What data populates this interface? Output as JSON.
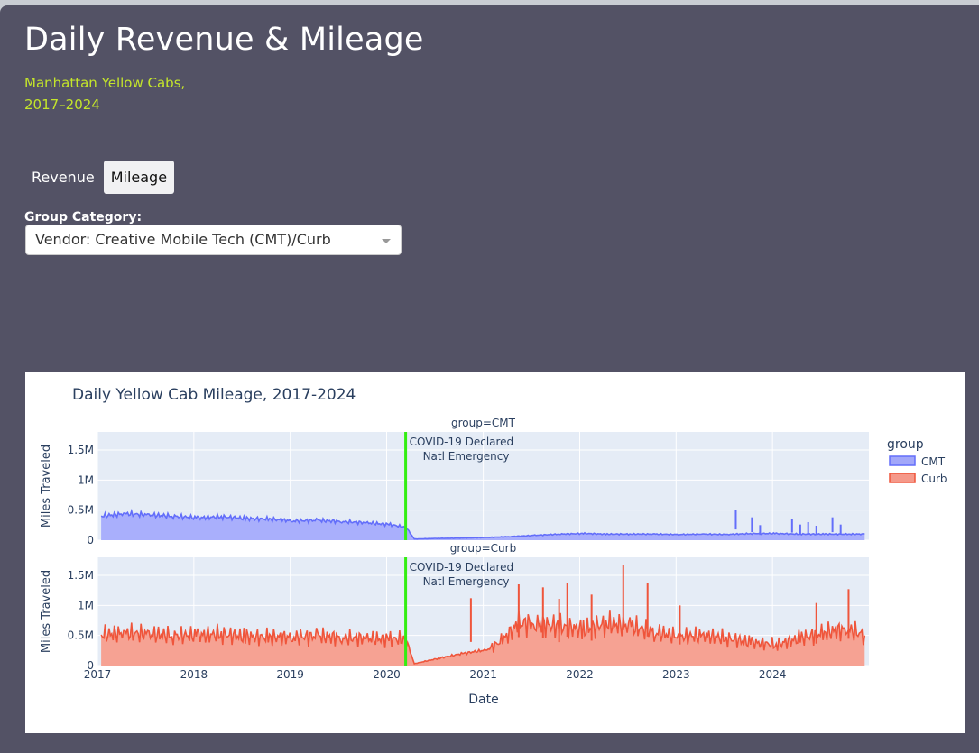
{
  "header": {
    "title": "Daily Revenue & Mileage",
    "subtitle_line1": "Manhattan Yellow Cabs,",
    "subtitle_line2": "2017–2024"
  },
  "tabs": [
    {
      "label": "Revenue",
      "active": false
    },
    {
      "label": "Mileage",
      "active": true
    }
  ],
  "group_select": {
    "label": "Group Category:",
    "value": "Vendor: Creative Mobile Tech (CMT)/Curb"
  },
  "colors": {
    "background": "#535265",
    "subtitle": "#c4e52b",
    "cmt": "#636efa",
    "curb": "#ef553b",
    "marker": "#33ee11",
    "plot_bg": "#e5ecf6"
  },
  "chart_data": {
    "type": "area",
    "title": "Daily Yellow Cab Mileage, 2017-2024",
    "xlabel": "Date",
    "ylabel": "Miles Traveled",
    "x_range": [
      "2017-01-01",
      "2024-12-31"
    ],
    "x_ticks": [
      "2017",
      "2018",
      "2019",
      "2020",
      "2021",
      "2022",
      "2023",
      "2024"
    ],
    "y_ticks": [
      "0",
      "0.5M",
      "1M",
      "1.5M"
    ],
    "ylim": [
      0,
      1800000
    ],
    "legend_title": "group",
    "legend_position": "right",
    "facets": [
      {
        "label": "group=CMT",
        "name": "CMT",
        "x": [
          "2017-01",
          "2017-04",
          "2017-07",
          "2017-10",
          "2018-01",
          "2018-04",
          "2018-07",
          "2018-10",
          "2019-01",
          "2019-04",
          "2019-07",
          "2019-10",
          "2020-01",
          "2020-03",
          "2020-04",
          "2020-07",
          "2020-10",
          "2021-01",
          "2021-04",
          "2021-07",
          "2021-10",
          "2022-01",
          "2022-04",
          "2022-07",
          "2022-10",
          "2023-01",
          "2023-04",
          "2023-07",
          "2023-10",
          "2024-01",
          "2024-04",
          "2024-07",
          "2024-10",
          "2024-12"
        ],
        "y": [
          400000,
          440000,
          420000,
          400000,
          370000,
          390000,
          360000,
          350000,
          320000,
          330000,
          310000,
          290000,
          260000,
          210000,
          20000,
          30000,
          35000,
          45000,
          60000,
          80000,
          100000,
          110000,
          100000,
          100000,
          100000,
          95000,
          100000,
          95000,
          110000,
          110000,
          100000,
          100000,
          100000,
          100000
        ],
        "spikes": [
          [
            "2023-08",
            510000
          ],
          [
            "2023-10",
            380000
          ],
          [
            "2023-11",
            250000
          ],
          [
            "2024-03",
            360000
          ],
          [
            "2024-04",
            260000
          ],
          [
            "2024-05",
            300000
          ],
          [
            "2024-06",
            240000
          ],
          [
            "2024-08",
            380000
          ],
          [
            "2024-09",
            260000
          ]
        ]
      },
      {
        "label": "group=Curb",
        "name": "Curb",
        "x": [
          "2017-01",
          "2017-04",
          "2017-07",
          "2017-10",
          "2018-01",
          "2018-04",
          "2018-07",
          "2018-10",
          "2019-01",
          "2019-04",
          "2019-07",
          "2019-10",
          "2020-01",
          "2020-03",
          "2020-04",
          "2020-07",
          "2020-10",
          "2021-01",
          "2021-03",
          "2021-05",
          "2021-07",
          "2021-10",
          "2022-01",
          "2022-04",
          "2022-07",
          "2022-10",
          "2023-01",
          "2023-04",
          "2023-07",
          "2023-10",
          "2024-01",
          "2024-04",
          "2024-07",
          "2024-10",
          "2024-12"
        ],
        "y": [
          510000,
          540000,
          520000,
          500000,
          500000,
          520000,
          480000,
          470000,
          470000,
          490000,
          460000,
          450000,
          440000,
          430000,
          30000,
          120000,
          200000,
          260000,
          420000,
          700000,
          700000,
          650000,
          600000,
          700000,
          650000,
          550000,
          480000,
          500000,
          450000,
          380000,
          350000,
          450000,
          550000,
          600000,
          500000
        ],
        "spikes": [
          [
            "2020-11",
            1120000
          ],
          [
            "2021-05",
            1350000
          ],
          [
            "2021-08",
            1300000
          ],
          [
            "2021-11",
            1370000
          ],
          [
            "2022-06",
            1680000
          ],
          [
            "2022-09",
            1380000
          ],
          [
            "2023-01",
            1000000
          ],
          [
            "2024-10",
            1270000
          ],
          [
            "2024-06",
            1040000
          ],
          [
            "2022-02",
            1180000
          ],
          [
            "2021-10",
            1110000
          ]
        ]
      }
    ],
    "annotation": {
      "x": "2020-03-13",
      "line1": "COVID-19 Declared",
      "line2": "Natl Emergency"
    }
  }
}
